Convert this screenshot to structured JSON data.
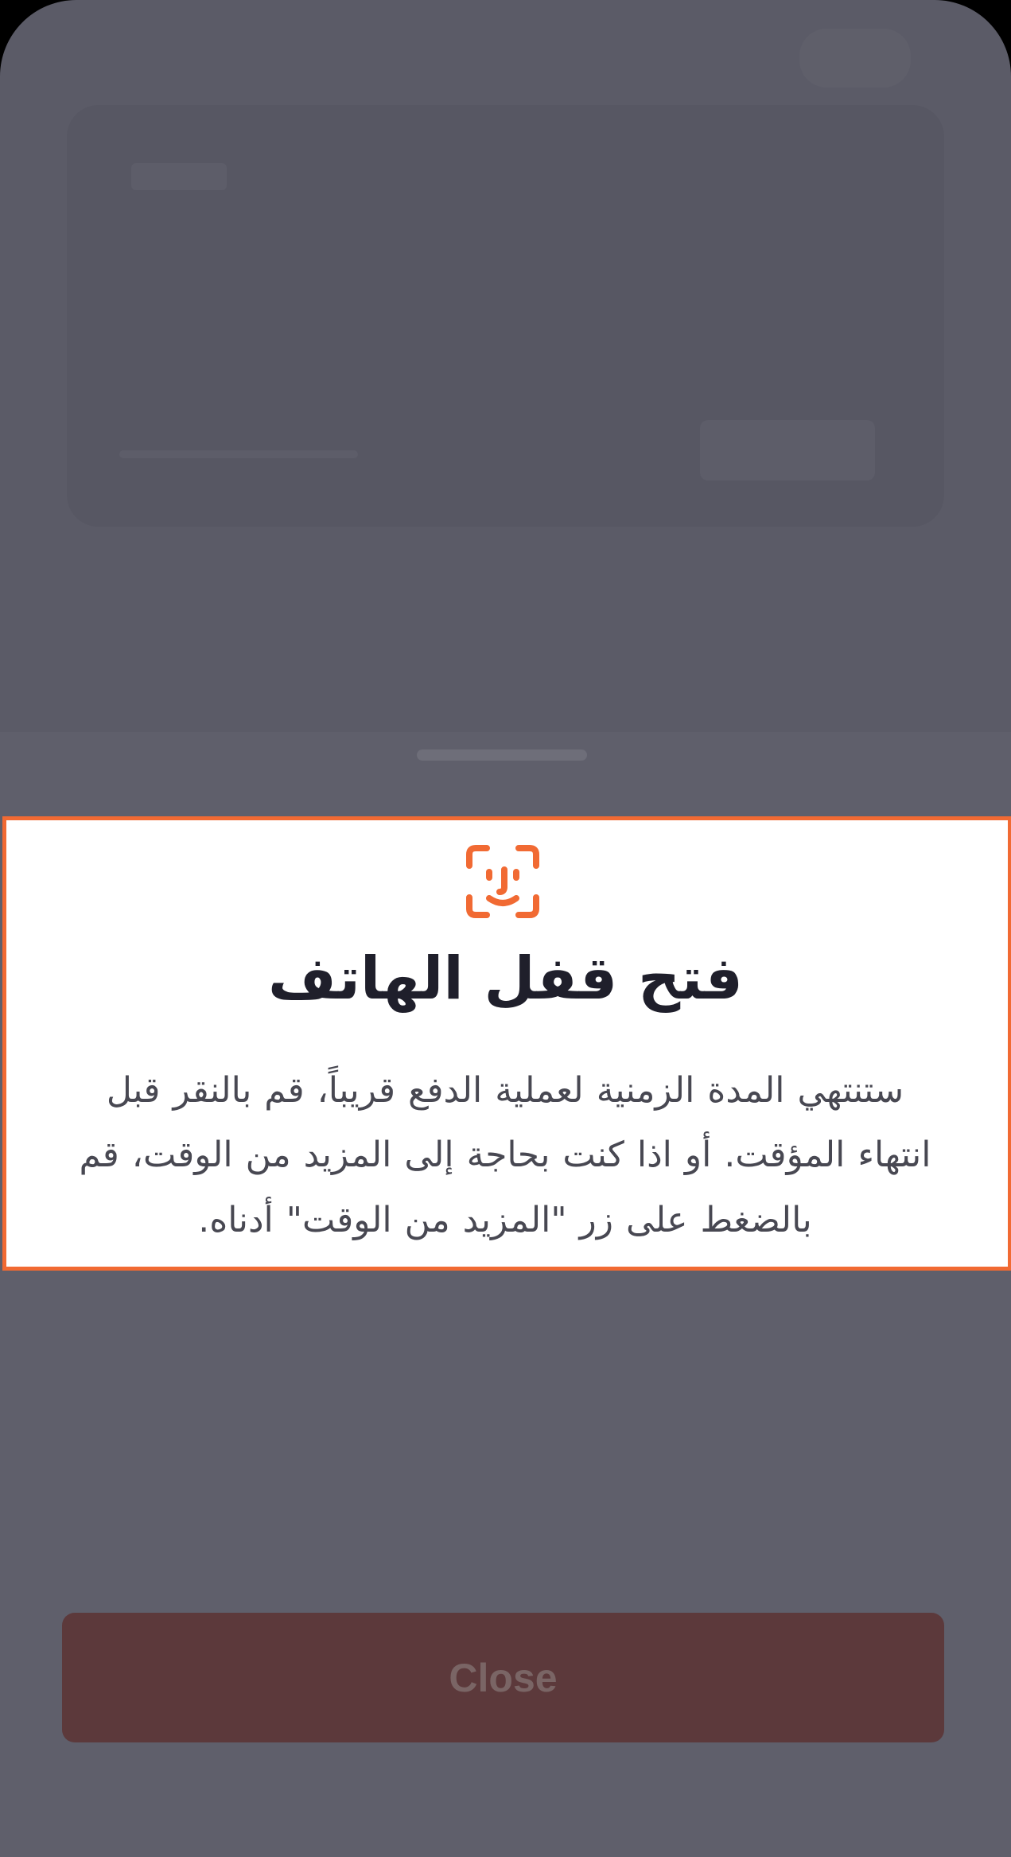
{
  "overlay": {
    "title": "فتح قفل الهاتف",
    "body": "ستنتهي المدة الزمنية لعملية الدفع قريباً، قم بالنقر قبل انتهاء المؤقت. أو اذا كنت بحاجة إلى المزيد من الوقت، قم بالضغط على زر \"المزيد من الوقت\" أدناه.",
    "icon": "face-id-icon"
  },
  "actions": {
    "close_label": "Close"
  },
  "colors": {
    "accent": "#f16a33",
    "background": "#5b5b67",
    "button": "#5c393b",
    "text": "#1f1f2b"
  }
}
